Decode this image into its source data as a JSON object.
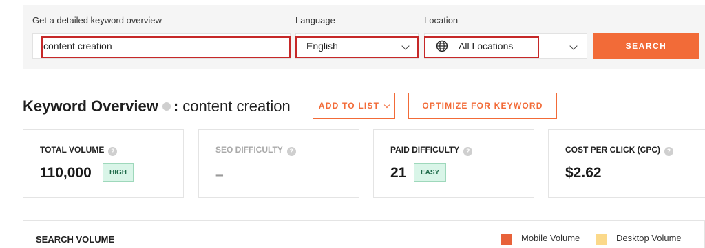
{
  "search": {
    "keyword_label": "Get a detailed keyword overview",
    "keyword_value": "content creation",
    "language_label": "Language",
    "language_value": "English",
    "location_label": "Location",
    "location_value": "All Locations",
    "search_button": "SEARCH",
    "globe_icon": "globe-icon"
  },
  "overview": {
    "title": "Keyword Overview",
    "separator": ":",
    "keyword": "content creation",
    "add_to_list": "ADD TO LIST",
    "optimize": "OPTIMIZE FOR KEYWORD"
  },
  "metrics": {
    "total_volume": {
      "label": "TOTAL VOLUME",
      "value": "110,000",
      "badge": "HIGH"
    },
    "seo_difficulty": {
      "label": "SEO DIFFICULTY",
      "value": "–"
    },
    "paid_difficulty": {
      "label": "PAID DIFFICULTY",
      "value": "21",
      "badge": "EASY"
    },
    "cpc": {
      "label": "COST PER CLICK (CPC)",
      "value": "$2.62"
    },
    "help_glyph": "?"
  },
  "search_volume": {
    "title": "SEARCH VOLUME",
    "legend": [
      {
        "label": "Mobile Volume",
        "color": "#e8623a"
      },
      {
        "label": "Desktop Volume",
        "color": "#fbd98a"
      }
    ]
  },
  "colors": {
    "accent": "#f26b38",
    "badge_bg": "#d9f5e8",
    "highlight": "#c62828"
  }
}
